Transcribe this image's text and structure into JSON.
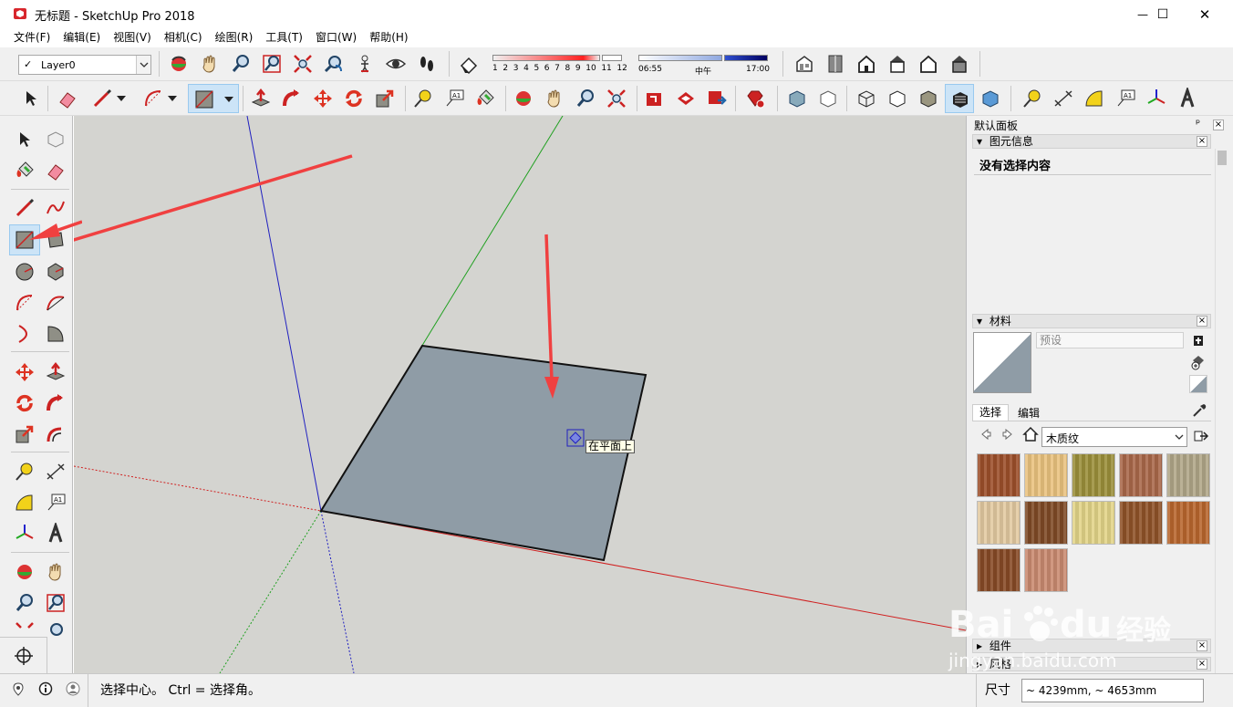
{
  "window": {
    "doc_title": "无标题",
    "separator": " - ",
    "app_name": "SketchUp Pro 2018",
    "minimize": "—",
    "maximize": "☐",
    "close": "✕"
  },
  "menu": [
    "文件(F)",
    "编辑(E)",
    "视图(V)",
    "相机(C)",
    "绘图(R)",
    "工具(T)",
    "窗口(W)",
    "帮助(H)"
  ],
  "layer_toolbar": {
    "check": "✓",
    "layer_name": "Layer0"
  },
  "shadows": {
    "months": [
      "1",
      "2",
      "3",
      "4",
      "5",
      "6",
      "7",
      "8",
      "9",
      "10",
      "11",
      "12"
    ],
    "time_start": "06:55",
    "time_mid": "中午",
    "time_end": "17:00"
  },
  "viewport": {
    "tooltip": "在平面上"
  },
  "default_tray": {
    "title": "默认面板",
    "pin": "ᵖ",
    "entity_info": {
      "header": "图元信息",
      "empty_text": "没有选择内容"
    },
    "materials": {
      "header": "材料",
      "name_placeholder": "预设",
      "tab_select": "选择",
      "tab_edit": "编辑",
      "library": "木质纹",
      "swatch_colors": [
        "#9c4f2a",
        "#e9c27e",
        "#9b8f3a",
        "#a9684a",
        "#b0a688",
        "#e2c9a0",
        "#7f4a26",
        "#e2d488",
        "#8f5228",
        "#b8662e",
        "#874a26",
        "#c98a70"
      ]
    },
    "components": {
      "header": "组件"
    },
    "styles": {
      "header": "风格"
    }
  },
  "status": {
    "hint": "选择中心。 Ctrl = 选择角。",
    "measure_label": "尺寸",
    "measure_value": "~ 4239mm, ~ 4653mm"
  },
  "watermark": {
    "brand": "Bai",
    "brand_tail": "du",
    "brand_cn": "经验",
    "url": "jingyan.baidu.com"
  },
  "colors": {
    "axis_red": "#d02020",
    "axis_green": "#20a020",
    "axis_blue": "#2020c0",
    "face": "#8f9ca6",
    "arrow": "#f04040",
    "sky": "#d4d4d0"
  }
}
